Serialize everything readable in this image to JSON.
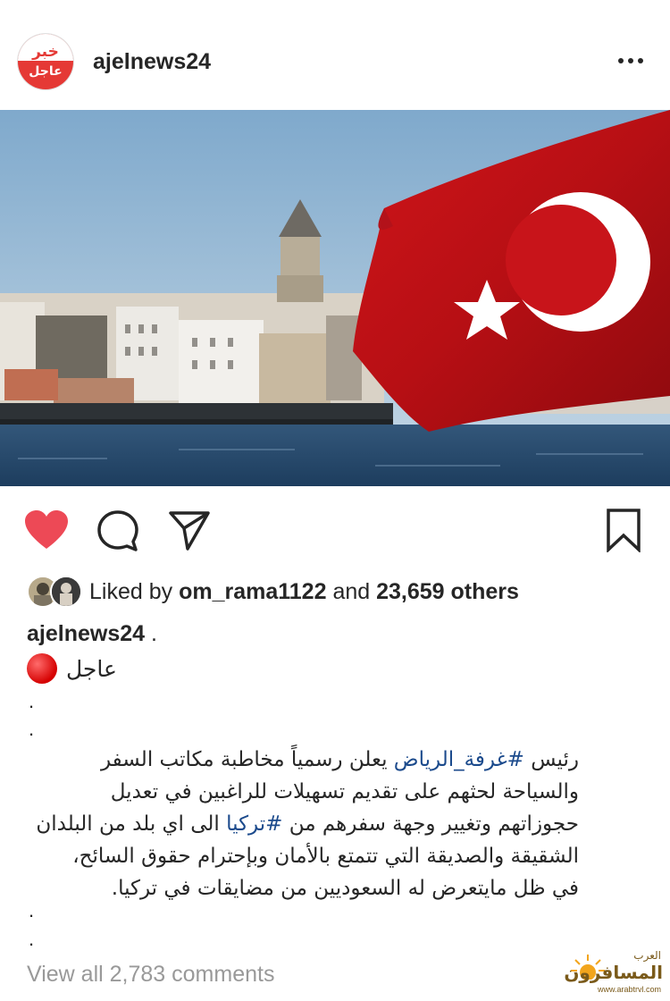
{
  "post": {
    "username": "ajelnews24",
    "avatar_text_top": "خبر",
    "avatar_text_bottom": "عاجل",
    "more_icon": "more-horizontal-icon"
  },
  "actions": {
    "like_icon": "heart-filled-icon",
    "comment_icon": "comment-icon",
    "share_icon": "send-icon",
    "save_icon": "bookmark-icon",
    "like_color": "#ed4956"
  },
  "likes": {
    "prefix": "Liked by",
    "user": "om_rama1122",
    "connector": "and",
    "count_text": "23,659 others"
  },
  "caption": {
    "username": "ajelnews24",
    "username_suffix": ".",
    "ajel": "عاجل",
    "dot1": ".",
    "dot2": ".",
    "line1_pre": "رئيس ",
    "line1_tag": "#غرفة_الرياض",
    "line1_post": " يعلن رسمياً مخاطبة مكاتب السفر",
    "line2": "والسياحة لحثهم على تقديم تسهيلات للراغبين في تعديل",
    "line3_pre": "حجوزاتهم وتغيير وجهة سفرهم من ",
    "line3_tag": "#تركيا",
    "line3_post": " الى اي بلد من البلدان",
    "line4": "الشقيقة والصديقة التي تتمتع بالأمان وبإحترام حقوق السائح،",
    "line5": "في ظل مايتعرض له السعوديين من مضايقات في تركيا.",
    "dot3": ".",
    "dot4": "."
  },
  "comments": {
    "view_all": "View all 2,783 comments"
  },
  "watermark": {
    "line1": "العرب",
    "line2": "المسافرون",
    "line3": "www.arabtrvl.com"
  }
}
